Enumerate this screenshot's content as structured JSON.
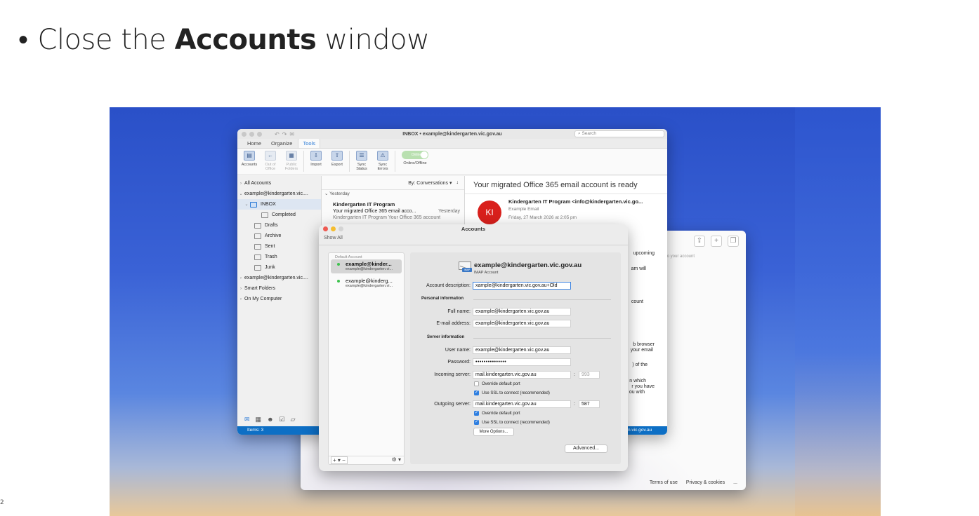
{
  "slide": {
    "bullet": "•",
    "heading_pre": "Close the",
    "heading_bold": "Accounts",
    "heading_post": "window",
    "page_number": "2"
  },
  "browser": {
    "hint": "to your account",
    "footer": [
      "Terms of use",
      "Privacy & cookies",
      "..."
    ],
    "toolbar_icons": [
      "share-icon",
      "plus-icon",
      "copy-icon"
    ]
  },
  "outlook": {
    "window_title": "INBOX • example@kindergarten.vic.gov.au",
    "search_placeholder": "Search",
    "tabs": [
      "Home",
      "Organize",
      "Tools"
    ],
    "active_tab": "Tools",
    "ribbon": [
      {
        "l1": "Accounts",
        "l2": "",
        "icon": "accounts-icon",
        "dim": false
      },
      {
        "l1": "Out of",
        "l2": "Office",
        "icon": "out-of-office-icon",
        "dim": true
      },
      {
        "l1": "Public",
        "l2": "Folders",
        "icon": "public-folders-icon",
        "dim": true
      },
      {
        "l1": "Import",
        "l2": "",
        "icon": "import-icon",
        "dim": false
      },
      {
        "l1": "Export",
        "l2": "",
        "icon": "export-icon",
        "dim": false
      },
      {
        "l1": "Sync",
        "l2": "Status",
        "icon": "sync-status-icon",
        "dim": false
      },
      {
        "l1": "Sync",
        "l2": "Errors",
        "icon": "sync-errors-icon",
        "dim": false
      }
    ],
    "toggle_label": "Online/Offline",
    "toggle_state": "Online",
    "sidebar": {
      "all_accounts": "All Accounts",
      "account1": "example@kindergarten.vic....",
      "inbox": "INBOX",
      "completed": "Completed",
      "drafts": "Drafts",
      "archive": "Archive",
      "sent": "Sent",
      "trash": "Trash",
      "junk": "Junk",
      "account2": "example@kindergarten.vic....",
      "smart_folders": "Smart Folders",
      "on_my_computer": "On My Computer"
    },
    "status": "Items: 3",
    "list": {
      "sort": "By: Conversations ▾",
      "group": "Yesterday",
      "from": "Kindergarten IT Program",
      "subject": "Your migrated Office 365 email acco...",
      "date": "Yesterday",
      "preview": "Kindergarten IT Program Your Office 365 account"
    },
    "reading": {
      "subject": "Your migrated Office 365 email account is ready",
      "avatar": "KI",
      "from": "Kindergarten IT Program <info@kindergarten.vic.go...",
      "to": "Example Email",
      "date": "Friday, 27 March 2026 at 2:05 pm",
      "fragments": [
        "upcoming",
        "am will",
        "count",
        "b browser",
        "your email",
        ") of the",
        "n which",
        "r you have",
        "ou with",
        "n.vic.gov.au"
      ]
    }
  },
  "accounts": {
    "title": "Accounts",
    "show_all": "Show All",
    "default_label": "Default Account",
    "list": [
      {
        "name": "example@kinder...",
        "email": "example@kindergarten.vi..."
      },
      {
        "name": "example@kinderg...",
        "email": "example@kindergarten.vi..."
      }
    ],
    "add_remove": "+ ▾ −",
    "gear": "⚙ ▾",
    "detail": {
      "title": "example@kindergarten.vic.gov.au",
      "type": "IMAP Account",
      "badge": "IMAP",
      "description_label": "Account description:",
      "description_value": "xample@kindergarten.vic.gov.au+Old",
      "personal_header": "Personal information",
      "fullname_label": "Full name:",
      "fullname_value": "example@kindergarten.vic.gov.au",
      "email_label": "E-mail address:",
      "email_value": "example@kindergarten.vic.gov.au",
      "server_header": "Server information",
      "username_label": "User name:",
      "username_value": "example@kindergarten.vic.gov.au",
      "password_label": "Password:",
      "password_value": "•••••••••••••••",
      "incoming_label": "Incoming server:",
      "incoming_value": "mail.kindergarten.vic.gov.au",
      "incoming_port": "993",
      "incoming_override": "Override default port",
      "incoming_ssl": "Use SSL to connect (recommended)",
      "outgoing_label": "Outgoing server:",
      "outgoing_value": "mail.kindergarten.vic.gov.au",
      "outgoing_port": "587",
      "outgoing_override": "Override default port",
      "outgoing_ssl": "Use SSL to connect (recommended)",
      "more_options": "More Options...",
      "advanced": "Advanced..."
    }
  }
}
